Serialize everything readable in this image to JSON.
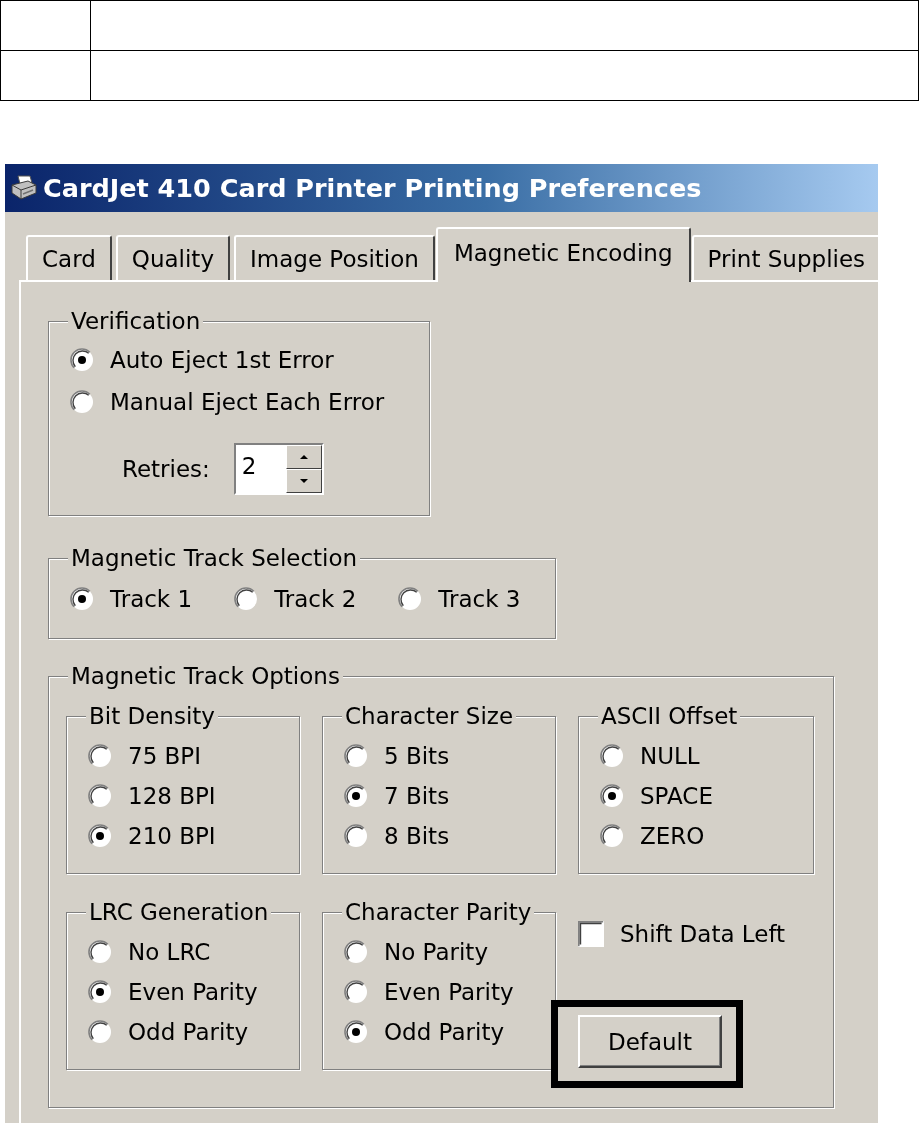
{
  "window": {
    "title": "CardJet 410 Card Printer Printing Preferences"
  },
  "tabs": [
    {
      "label": "Card",
      "selected": false
    },
    {
      "label": "Quality",
      "selected": false
    },
    {
      "label": "Image Position",
      "selected": false
    },
    {
      "label": "Magnetic Encoding",
      "selected": true
    },
    {
      "label": "Print Supplies",
      "selected": false
    }
  ],
  "verification": {
    "legend": "Verification",
    "options": [
      {
        "label": "Auto Eject 1st Error",
        "selected": true
      },
      {
        "label": "Manual Eject Each Error",
        "selected": false
      }
    ],
    "retries": {
      "label": "Retries:",
      "value": "2"
    }
  },
  "track_selection": {
    "legend": "Magnetic Track Selection",
    "options": [
      {
        "label": "Track 1",
        "selected": true
      },
      {
        "label": "Track 2",
        "selected": false
      },
      {
        "label": "Track 3",
        "selected": false
      }
    ]
  },
  "track_options": {
    "legend": "Magnetic Track Options",
    "groups": [
      {
        "legend": "Bit Density",
        "options": [
          {
            "label": "75 BPI",
            "selected": false
          },
          {
            "label": "128 BPI",
            "selected": false
          },
          {
            "label": "210 BPI",
            "selected": true
          }
        ]
      },
      {
        "legend": "Character Size",
        "options": [
          {
            "label": "5 Bits",
            "selected": false
          },
          {
            "label": "7 Bits",
            "selected": true
          },
          {
            "label": "8 Bits",
            "selected": false
          }
        ]
      },
      {
        "legend": "ASCII Offset",
        "options": [
          {
            "label": "NULL",
            "selected": false
          },
          {
            "label": "SPACE",
            "selected": true
          },
          {
            "label": "ZERO",
            "selected": false
          }
        ]
      },
      {
        "legend": "LRC Generation",
        "options": [
          {
            "label": "No LRC",
            "selected": false
          },
          {
            "label": "Even Parity",
            "selected": true
          },
          {
            "label": "Odd Parity",
            "selected": false
          }
        ]
      },
      {
        "legend": "Character Parity",
        "options": [
          {
            "label": "No Parity",
            "selected": false
          },
          {
            "label": "Even Parity",
            "selected": false
          },
          {
            "label": "Odd Parity",
            "selected": true
          }
        ]
      }
    ],
    "shift_data_left": {
      "label": "Shift Data Left",
      "checked": false
    },
    "default_button": {
      "label": "Default",
      "highlighted": true
    }
  }
}
